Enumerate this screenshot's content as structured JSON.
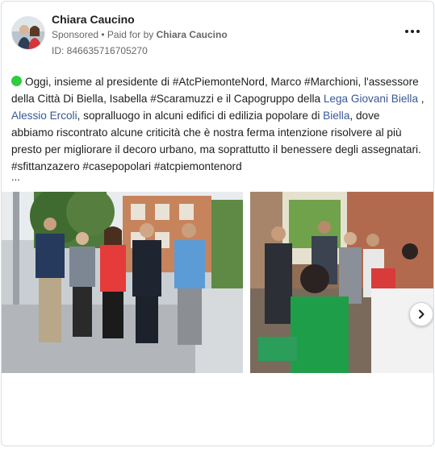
{
  "ad": {
    "page_name": "Chiara Caucino",
    "sponsored_label": "Sponsored",
    "paid_for_prefix": "• Paid for by",
    "paid_for_name": "Chiara Caucino",
    "ad_id": "ID: 846635716705270",
    "more_icon": "more-options-icon"
  },
  "post": {
    "status_icon": "green-circle-icon",
    "status_color": "#2ecc40",
    "mention_color": "#385898",
    "text_1": "Oggi, insieme al presidente di #AtcPiemonteNord, Marco #Marchioni, l'assessore della Città Di Biella, Isabella #Scaramuzzi e il Capogruppo della ",
    "mention_1": "Lega Giovani Biella",
    "text_2": " , ",
    "mention_2": "Alessio Ercoli",
    "text_3": ", sopralluogo in alcuni edifici di edilizia popolare di ",
    "mention_3": "Biella",
    "text_4": ", dove abbiamo riscontrato alcune criticità che è nostra ferma intenzione risolvere al più presto per migliorare il decoro urbano, ma soprattutto il benessere degli assegnatari. #sfittanzazero #casepopolari #atcpiemontenord",
    "see_more": "..."
  },
  "carousel": {
    "photos": [
      "group-photo",
      "meeting-photo"
    ],
    "next_icon": "chevron-right-icon"
  }
}
